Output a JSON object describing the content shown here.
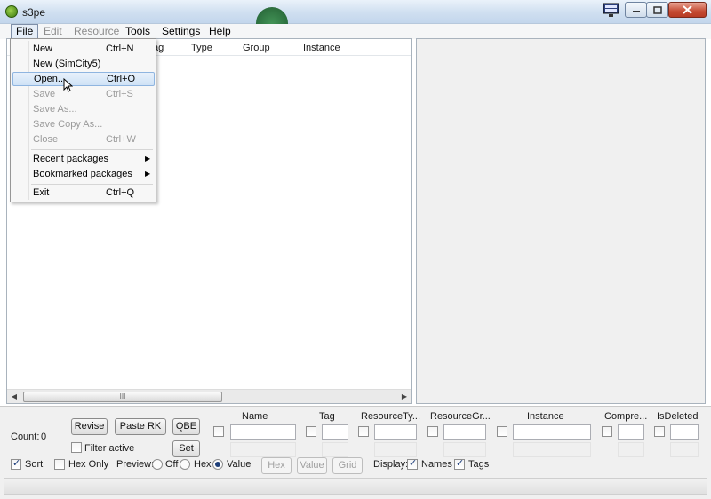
{
  "window": {
    "title": "s3pe"
  },
  "menubar": {
    "items": [
      {
        "label": "File"
      },
      {
        "label": "Edit"
      },
      {
        "label": "Resource"
      },
      {
        "label": "Tools"
      },
      {
        "label": "Settings"
      },
      {
        "label": "Help"
      }
    ]
  },
  "table": {
    "columns": [
      "Tag",
      "Type",
      "Group",
      "Instance"
    ],
    "visible_partial_tag": "ag",
    "scrollbar_grip": "III"
  },
  "file_menu": {
    "items": [
      {
        "label": "New",
        "shortcut": "Ctrl+N",
        "enabled": true
      },
      {
        "label": "New (SimCity5)",
        "shortcut": "",
        "enabled": true
      },
      {
        "label": "Open...",
        "shortcut": "Ctrl+O",
        "enabled": true,
        "highlighted": true
      },
      {
        "label": "Save",
        "shortcut": "Ctrl+S",
        "enabled": false
      },
      {
        "label": "Save As...",
        "shortcut": "",
        "enabled": false
      },
      {
        "label": "Save Copy As...",
        "shortcut": "",
        "enabled": false
      },
      {
        "label": "Close",
        "shortcut": "Ctrl+W",
        "enabled": false
      },
      {
        "label": "Recent packages",
        "submenu": true,
        "enabled": true
      },
      {
        "label": "Bookmarked packages",
        "submenu": true,
        "enabled": true
      },
      {
        "label": "Exit",
        "shortcut": "Ctrl+Q",
        "enabled": true
      }
    ],
    "submenu_arrow": "▶"
  },
  "bottom": {
    "count_label": "Count:",
    "count_value": "0",
    "revise": "Revise",
    "paste_rk": "Paste RK",
    "qbe": "QBE",
    "filter_active": "Filter active",
    "set": "Set",
    "sort": "Sort",
    "hex_only": "Hex Only",
    "preview_label": "Preview:",
    "preview_off": "Off",
    "preview_hex": "Hex",
    "preview_value": "Value",
    "hex_btn": "Hex",
    "value_btn": "Value",
    "grid_btn": "Grid",
    "display_label": "Display:",
    "names": "Names",
    "tags": "Tags",
    "filter_columns": [
      "Name",
      "Tag",
      "ResourceTy...",
      "ResourceGr...",
      "Instance",
      "Compre...",
      "IsDeleted"
    ]
  },
  "state": {
    "sort_checked": true,
    "hex_only_checked": false,
    "filter_active_checked": false,
    "preview_selected": "Value",
    "display_names_checked": true,
    "display_tags_checked": true
  }
}
